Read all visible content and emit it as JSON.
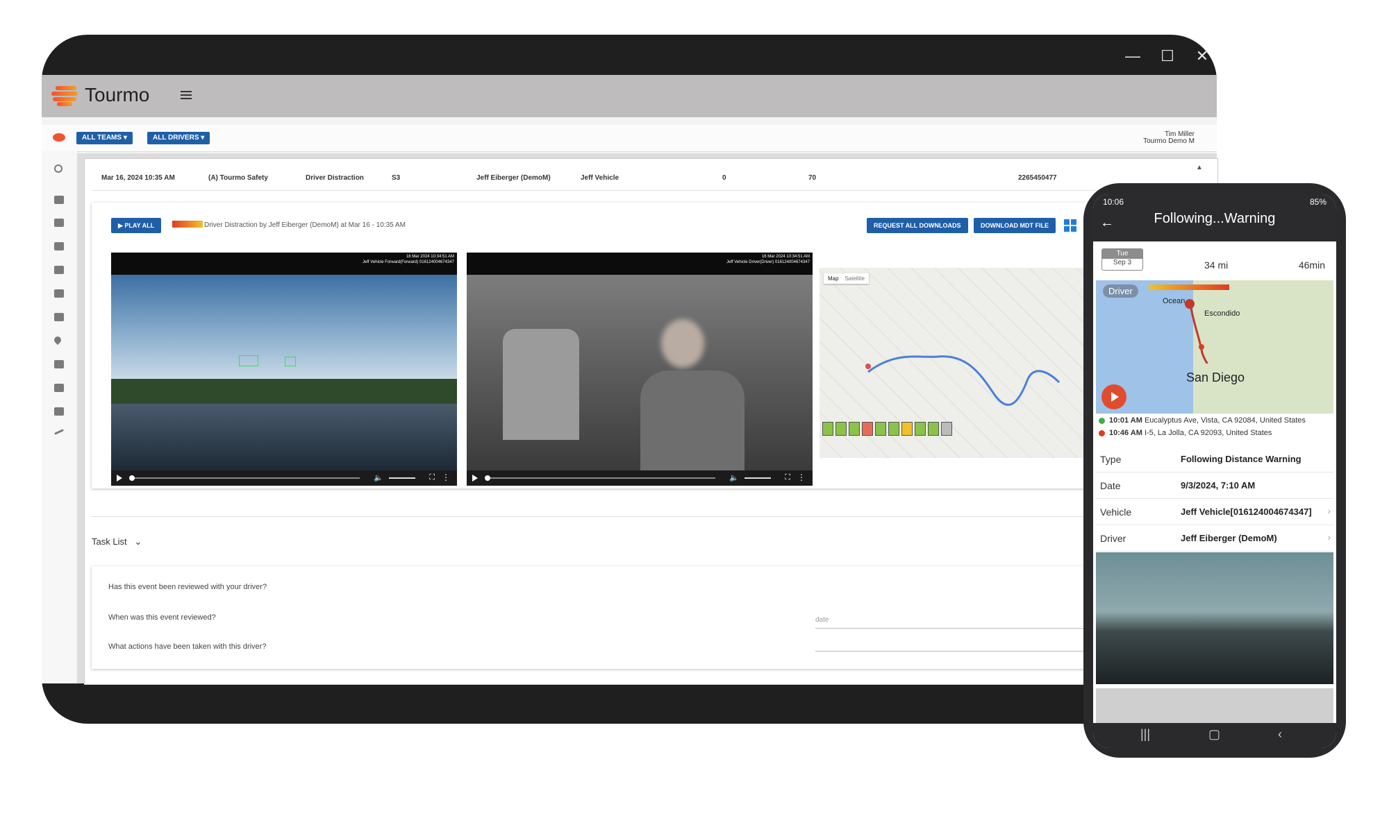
{
  "desktop": {
    "app_name": "Tourmo",
    "window_controls": {
      "minimize": "—",
      "maximize": "☐",
      "close": "✕"
    },
    "filters": {
      "teams": "ALL TEAMS",
      "drivers": "ALL DRIVERS"
    },
    "user": {
      "name": "Tim Miller",
      "org": "Tourmo Demo M"
    },
    "event_row": {
      "datetime": "Mar 16, 2024 10:35 AM",
      "group": "(A) Tourmo Safety",
      "event_type": "Driver Distraction",
      "severity": "S3",
      "driver": "Jeff Eiberger (DemoM)",
      "vehicle": "Jeff Vehicle",
      "value1": "0",
      "value2": "70",
      "id": "2265450477"
    },
    "player": {
      "play_all": "PLAY ALL",
      "caption": "Driver Distraction by Jeff Eiberger (DemoM) at Mar 16 - 10:35 AM",
      "request_downloads": "REQUEST ALL DOWNLOADS",
      "download_mdt": "DOWNLOAD MDT FILE"
    },
    "video_front": {
      "stamp_line1": "16 Mar 2024 10:34:51 AM",
      "stamp_line2": "Jeff Vehicle Forward(Forward) 016124004674347"
    },
    "video_cabin": {
      "stamp_line1": "16 Mar 2024 10:34:51 AM",
      "stamp_line2": "Jeff Vehicle Driver(Driver) 016124004674347"
    },
    "map": {
      "tab_map": "Map",
      "tab_satellite": "Satellite"
    },
    "task_list": {
      "title": "Task List",
      "q1": "Has this event been reviewed with your driver?",
      "q2": "When was this event reviewed?",
      "q3": "What actions have been taken with this driver?",
      "date_placeholder": "date"
    }
  },
  "phone": {
    "status_time": "10:06",
    "battery": "85%",
    "title": "Following...Warning",
    "date_day": "Tue",
    "date_date": "Sep 3",
    "distance": "34 mi",
    "duration": "46min",
    "driver_badge": "Driver",
    "map_labels": {
      "oceanside": "Ocean",
      "escondido": "Escondido",
      "san_diego": "San Diego"
    },
    "start": {
      "time": "10:01 AM",
      "address": "Eucalyptus Ave, Vista, CA 92084, United States"
    },
    "end": {
      "time": "10:46 AM",
      "address": "I-5, La Jolla, CA 92093, United States"
    },
    "details": [
      {
        "key": "Type",
        "value": "Following Distance Warning"
      },
      {
        "key": "Date",
        "value": "9/3/2024, 7:10 AM"
      },
      {
        "key": "Vehicle",
        "value": "Jeff Vehicle[016124004674347]"
      },
      {
        "key": "Driver",
        "value": "Jeff Eiberger (DemoM)"
      }
    ]
  },
  "colors": {
    "accent": "#1f5fa8",
    "brand_orange": "#f0542d",
    "start_green": "#3cb043",
    "end_red": "#e03b24"
  }
}
